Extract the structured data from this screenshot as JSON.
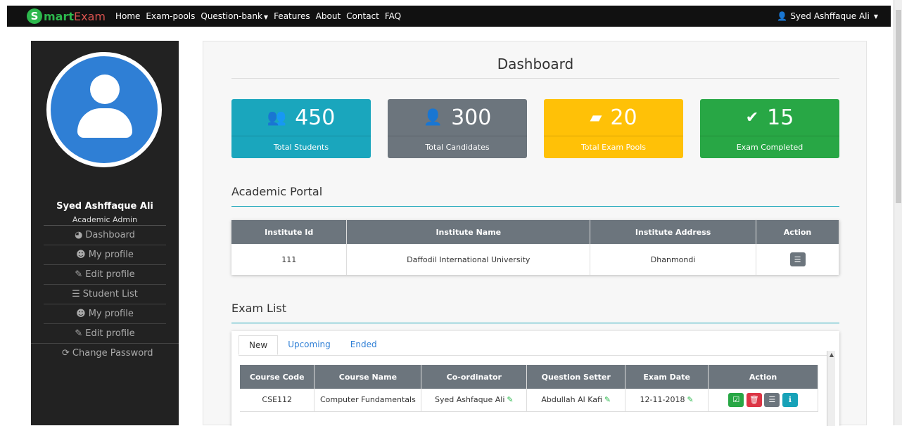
{
  "brand": {
    "letter": "S",
    "smart": "mart",
    "exam": "Exam"
  },
  "nav": {
    "items": [
      {
        "label": "Home",
        "name": "nav-home"
      },
      {
        "label": "Exam-pools",
        "name": "nav-exam-pools"
      },
      {
        "label": "Question-bank",
        "name": "nav-question-bank"
      },
      {
        "label": "Features",
        "name": "nav-features"
      },
      {
        "label": "About",
        "name": "nav-about"
      },
      {
        "label": "Contact",
        "name": "nav-contact"
      },
      {
        "label": "FAQ",
        "name": "nav-faq"
      }
    ],
    "user": "Syed Ashffaque Ali"
  },
  "sidebar": {
    "name": "Syed Ashffaque Ali",
    "role": "Academic Admin",
    "items": [
      {
        "label": "Dashboard",
        "icon": "dashboard-icon",
        "glyph": "◕"
      },
      {
        "label": "My profile",
        "icon": "user-circle-icon",
        "glyph": "☻"
      },
      {
        "label": "Edit profile",
        "icon": "edit-icon",
        "glyph": "✎"
      },
      {
        "label": "Student List",
        "icon": "list-icon",
        "glyph": "☰"
      },
      {
        "label": "My profile",
        "icon": "user-circle-icon",
        "glyph": "☻"
      },
      {
        "label": "Edit profile",
        "icon": "edit-icon",
        "glyph": "✎"
      },
      {
        "label": "Change Password",
        "icon": "refresh-icon",
        "glyph": "⟳"
      }
    ]
  },
  "dashboard": {
    "title": "Dashboard",
    "stats": [
      {
        "value": "450",
        "label": "Total Students",
        "icon": "users-icon",
        "glyph": "👥",
        "color": "#1aa6bd"
      },
      {
        "value": "300",
        "label": "Total Candidates",
        "icon": "user-plus-icon",
        "glyph": "👤",
        "color": "#6c757d"
      },
      {
        "value": "20",
        "label": "Total Exam Pools",
        "icon": "book-icon",
        "glyph": "▰",
        "color": "#ffc107"
      },
      {
        "value": "15",
        "label": "Exam Completed",
        "icon": "check-icon",
        "glyph": "✔",
        "color": "#28a745"
      }
    ]
  },
  "portal": {
    "title": "Academic Portal",
    "columns": [
      "Institute Id",
      "Institute Name",
      "Institute Address",
      "Action"
    ],
    "rows": [
      {
        "id": "111",
        "name": "Daffodil International University",
        "address": "Dhanmondi"
      }
    ]
  },
  "exams": {
    "title": "Exam List",
    "tabs": [
      "New",
      "Upcoming",
      "Ended"
    ],
    "columns": [
      "Course Code",
      "Course Name",
      "Co-ordinator",
      "Question Setter",
      "Exam Date",
      "Action"
    ],
    "rows": [
      {
        "code": "CSE112",
        "course": "Computer Fundamentals",
        "coordinator": "Syed Ashfaque Ali",
        "setter": "Abdullah Al Kafi",
        "date": "12-11-2018"
      }
    ]
  }
}
